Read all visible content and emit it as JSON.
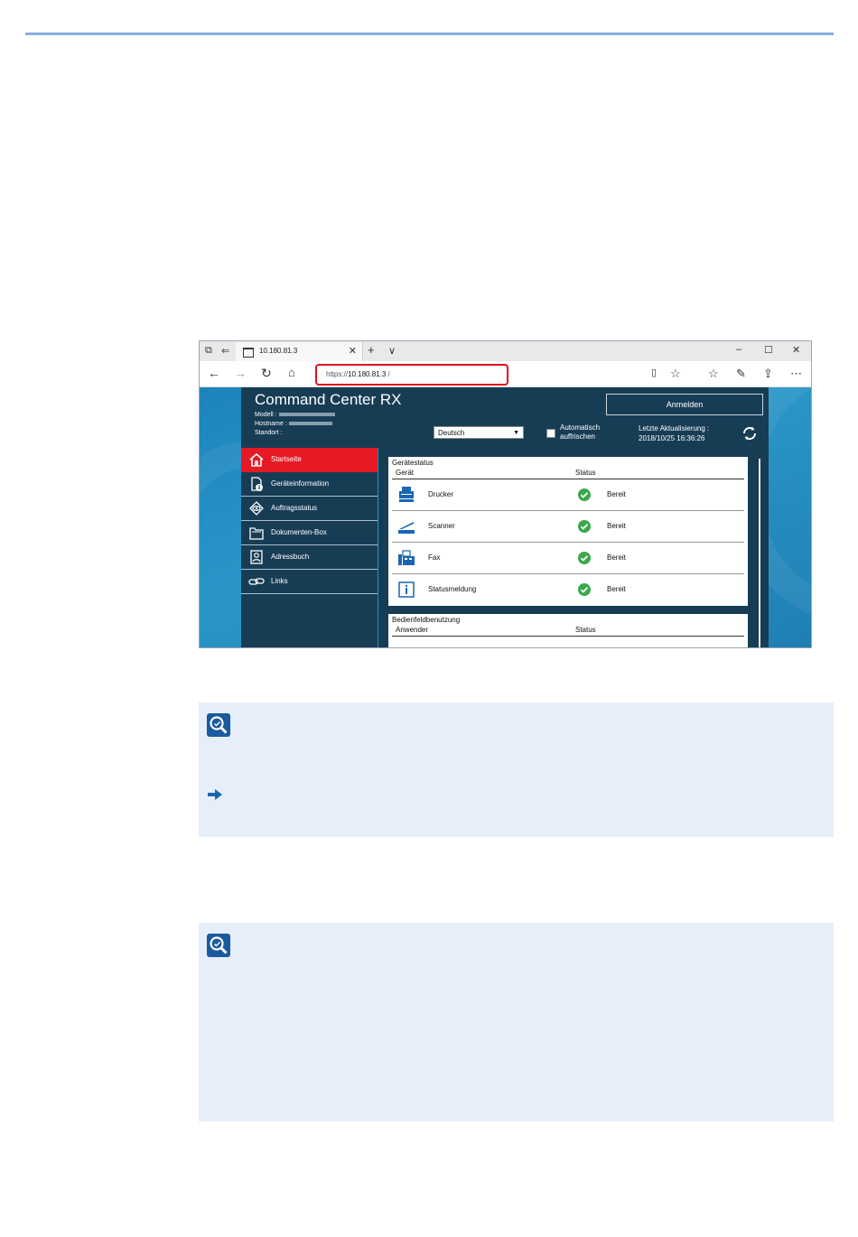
{
  "colors": {
    "page_rule": "#86aedc",
    "url_highlight": "#e0131c",
    "header_bg": "#173d55",
    "active_menu": "#e51a25",
    "note_bg": "#e6eefa",
    "ok_green": "#3aa84a",
    "icon_blue": "#1a66b2"
  },
  "browser": {
    "tab_title": "10.180.81.3",
    "new_tab_glyph": "+",
    "tab_menu_glyph": "∨",
    "url_prefix": "https://",
    "url_host": "10.180.81.3",
    "url_suffix": " /",
    "icons": [
      "window-icon",
      "tab-back-icon",
      "close-icon",
      "minimize-icon",
      "maximize-icon",
      "back-arrow-icon",
      "forward-arrow-icon",
      "refresh-icon",
      "home-icon",
      "reading-view-icon",
      "favorite-star-icon",
      "favorites-list-icon",
      "pen-icon",
      "share-icon",
      "more-icon"
    ]
  },
  "ccrx": {
    "title": "Command Center RX",
    "model_label": "Modell :",
    "hostname_label": "Hostname :",
    "location_label": "Standort :",
    "login_button": "Anmelden",
    "language": "Deutsch",
    "auto_refresh_line1": "Automatisch",
    "auto_refresh_line2": "auffrischen",
    "last_update_label": "Letzte Aktualisierung :",
    "last_update_value": "2018/10/25 16:36:26"
  },
  "sidebar": {
    "items": [
      {
        "label": "Startseite",
        "icon": "home-icon"
      },
      {
        "label": "Geräteinformation",
        "icon": "device-info-icon"
      },
      {
        "label": "Auftragsstatus",
        "icon": "eye-icon"
      },
      {
        "label": "Dokumenten-Box",
        "icon": "folder-icon"
      },
      {
        "label": "Adressbuch",
        "icon": "address-book-icon"
      },
      {
        "label": "Links",
        "icon": "link-icon"
      }
    ]
  },
  "device_status": {
    "title": "Gerätestatus",
    "col_device": "Gerät",
    "col_status": "Status",
    "rows": [
      {
        "name": "Drucker",
        "status": "Bereit",
        "icon": "printer-icon"
      },
      {
        "name": "Scanner",
        "status": "Bereit",
        "icon": "scanner-icon"
      },
      {
        "name": "Fax",
        "status": "Bereit",
        "icon": "fax-icon"
      },
      {
        "name": "Statusmeldung",
        "status": "Bereit",
        "icon": "info-icon"
      }
    ]
  },
  "panel_usage": {
    "title": "Bedienfeldbenutzung",
    "col_user": "Anwender",
    "col_status": "Status"
  }
}
